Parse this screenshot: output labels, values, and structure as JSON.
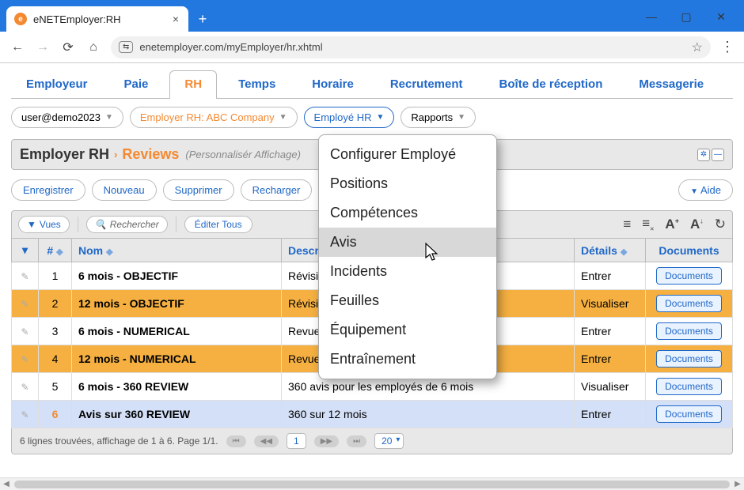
{
  "browser": {
    "tab_title": "eNETEmployer:RH",
    "url": "enetemployer.com/myEmployer/hr.xhtml"
  },
  "app_tabs": [
    "Employeur",
    "Paie",
    "RH",
    "Temps",
    "Horaire",
    "Recrutement",
    "Boîte de réception",
    "Messagerie"
  ],
  "active_tab_index": 2,
  "dropdowns": {
    "user": "user@demo2023",
    "employer": "Employer RH: ABC Company",
    "employee": "Employé HR",
    "reports": "Rapports"
  },
  "page_header": {
    "title": "Employer RH",
    "subtitle": "Reviews",
    "note": "(Personnalisér Affichage)"
  },
  "actions": {
    "save": "Enregistrer",
    "new": "Nouveau",
    "delete": "Supprimer",
    "reload": "Recharger",
    "help": "Aide"
  },
  "toolbar": {
    "views": "Vues",
    "search": "Rechercher",
    "edit_all": "Éditer Tous"
  },
  "table": {
    "headers": {
      "num": "#",
      "name": "Nom",
      "description": "Description",
      "details": "Détails",
      "documents": "Documents"
    },
    "rows": [
      {
        "n": "1",
        "name": "6 mois - OBJECTIF",
        "desc": "Révision",
        "details": "Entrer",
        "hl": ""
      },
      {
        "n": "2",
        "name": "12 mois - OBJECTIF",
        "desc": "Révision",
        "details": "Visualiser",
        "hl": "orange"
      },
      {
        "n": "3",
        "name": "6 mois - NUMERICAL",
        "desc": "Revue nu",
        "details": "Entrer",
        "hl": ""
      },
      {
        "n": "4",
        "name": "12 mois - NUMERICAL",
        "desc": "Revue nu",
        "details": "Entrer",
        "hl": "orange"
      },
      {
        "n": "5",
        "name": "6 mois - 360 REVIEW",
        "desc": "360 avis pour les employés de 6 mois",
        "details": "Visualiser",
        "hl": ""
      },
      {
        "n": "6",
        "name": "Avis sur 360 REVIEW",
        "desc": "360 sur 12 mois",
        "details": "Entrer",
        "hl": "blue"
      }
    ],
    "doc_button": "Documents"
  },
  "pagination": {
    "summary": "6 lignes trouvées, affichage de 1 à 6. Page 1/1.",
    "current": "1",
    "page_size": "20"
  },
  "menu": {
    "items": [
      "Configurer Employé",
      "Positions",
      "Compétences",
      "Avis",
      "Incidents",
      "Feuilles",
      "Équipement",
      "Entraînement"
    ],
    "active_index": 3
  }
}
